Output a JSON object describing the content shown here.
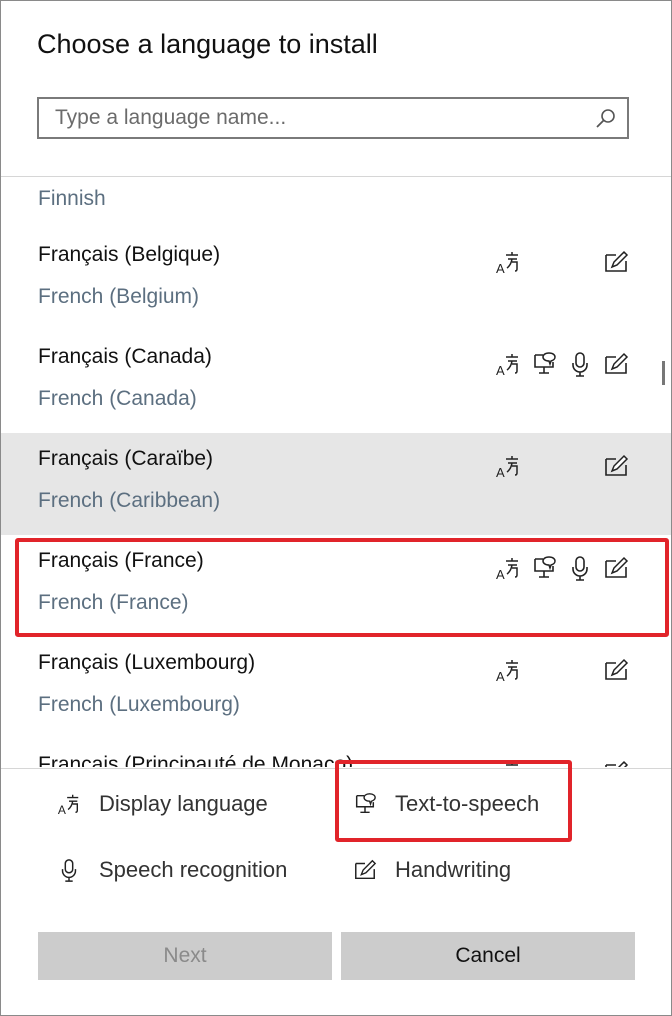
{
  "dialog": {
    "title": "Choose a language to install",
    "search_placeholder": "Type a language name...",
    "search_value": ""
  },
  "languages": [
    {
      "name": "Finnish",
      "features": []
    },
    {
      "name": "Français (Belgique)",
      "english": "French (Belgium)",
      "features": [
        "display-language",
        "handwriting"
      ]
    },
    {
      "name": "Français (Canada)",
      "english": "French (Canada)",
      "features": [
        "display-language",
        "text-to-speech",
        "speech-recognition",
        "handwriting"
      ]
    },
    {
      "name": "Français (Caraïbe)",
      "english": "French (Caribbean)",
      "features": [
        "display-language",
        "handwriting"
      ]
    },
    {
      "name": "Français (France)",
      "english": "French (France)",
      "features": [
        "display-language",
        "text-to-speech",
        "speech-recognition",
        "handwriting"
      ]
    },
    {
      "name": "Français (Luxembourg)",
      "english": "French (Luxembourg)",
      "features": [
        "display-language",
        "handwriting"
      ]
    },
    {
      "name": "Français (Principauté de Monaco)",
      "features": [
        "display-language",
        "handwriting"
      ]
    }
  ],
  "legend": {
    "display_language": "Display language",
    "text_to_speech": "Text-to-speech",
    "speech_recognition": "Speech recognition",
    "handwriting": "Handwriting"
  },
  "buttons": {
    "next": "Next",
    "cancel": "Cancel"
  },
  "colors": {
    "highlight": "#e1242a",
    "hover_row": "#e6e6e6",
    "button": "#cccccc",
    "secondary_text": "#5c6f80"
  }
}
